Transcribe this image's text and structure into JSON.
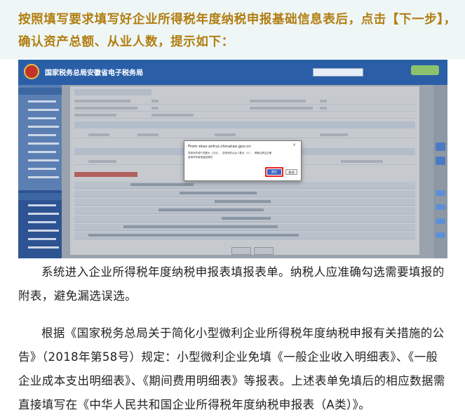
{
  "heading": {
    "text": "按照填写要求填写好企业所得税年度纳税申报基础信息表后，点击【下一步】，确认资产总额、从业人数，提示如下："
  },
  "screenshot": {
    "portal_title": "国家税务总局安徽省电子税务局",
    "dialog": {
      "from": "From etax.anhui.chinatax.gov.cn",
      "message_line1": "您填写的资产总额为（万元），您填写的从业人数为（人），请确认是否正确",
      "message_line2": "若填写有误请返回修改",
      "ok_label": "确定",
      "cancel_label": "取消",
      "close_glyph": "×"
    }
  },
  "paragraph1": {
    "text": "系统进入企业所得税年度纳税申报表填报表单。纳税人应准确勾选需要填报的附表，避免漏选误选。"
  },
  "paragraph2": {
    "text": "根据《国家税务总局关于简化小型微利企业所得税年度纳税申报有关措施的公告》（2018年第58号）规定：小型微利企业免填《一般企业收入明细表》、《一般企业成本支出明细表》、《期间费用明细表》等报表。上述表单免填后的相应数据需直接填写在《中华人民共和国企业所得税年度纳税申报表（A类）》。"
  }
}
